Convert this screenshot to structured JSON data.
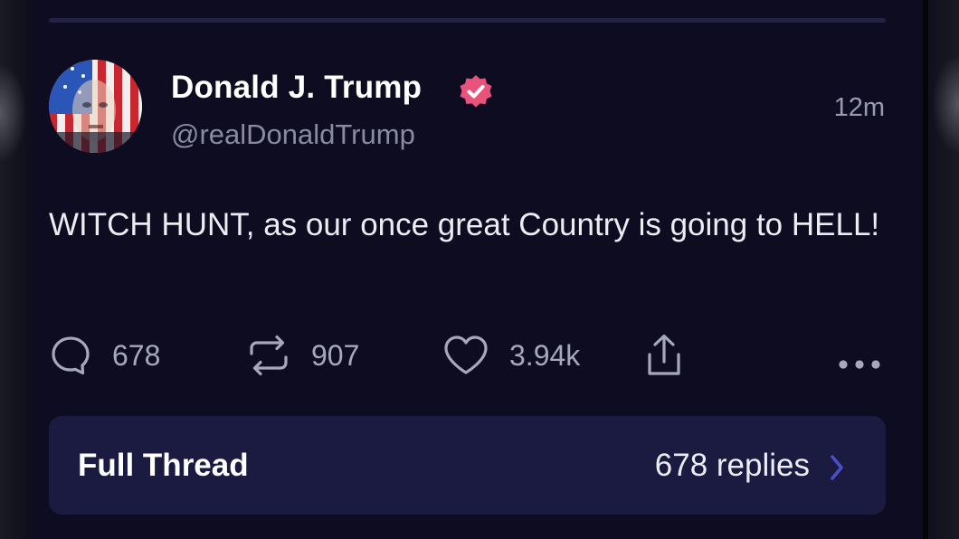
{
  "post": {
    "author_name": "Donald J. Trump",
    "handle": "@realDonaldTrump",
    "timestamp": "12m",
    "verified_icon": "verified-badge-icon",
    "text": "WITCH HUNT, as our once great Country is going to HELL!"
  },
  "actions": {
    "reply_count": "678",
    "repost_count": "907",
    "like_count": "3.94k"
  },
  "thread": {
    "label": "Full Thread",
    "replies": "678 replies"
  },
  "colors": {
    "background": "#0d0c20",
    "thread_box": "#1b1a40",
    "verified_badge": "#e9527b",
    "chevron": "#4b4fc6"
  }
}
